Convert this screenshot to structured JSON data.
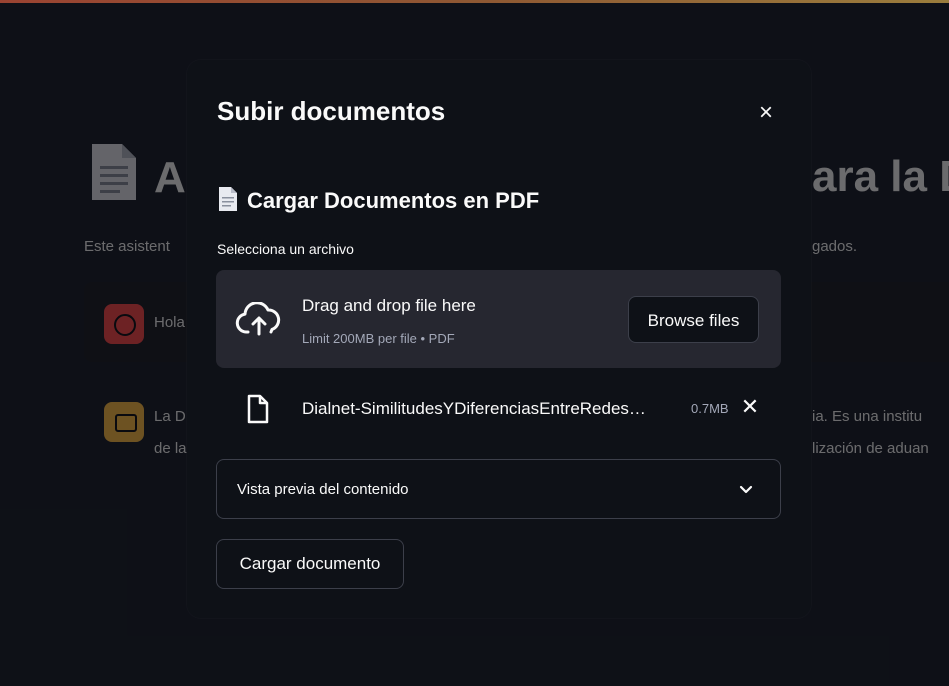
{
  "background": {
    "title_left": "A",
    "title_right": "ara la D",
    "caption_left": "Este asistent",
    "caption_right": "gados.",
    "user_message": "Hola",
    "bot_line1_left": "La D",
    "bot_line1_right": "ia. Es una institu",
    "bot_line2_left": "de la",
    "bot_line2_right": "lización de aduan"
  },
  "modal": {
    "title": "Subir documentos",
    "close_label": "×",
    "section_title": "Cargar Documentos en PDF",
    "uploader": {
      "label": "Selecciona un archivo",
      "drop_text": "Drag and drop file here",
      "limit_text": "Limit 200MB per file • PDF",
      "browse_label": "Browse files"
    },
    "uploaded_file": {
      "name": "Dialnet-SimilitudesYDiferenciasEntreRedes…",
      "size": "0.7MB",
      "remove_label": "✕"
    },
    "expander_label": "Vista previa del contenido",
    "submit_label": "Cargar documento"
  },
  "icons": {
    "document": "document-icon",
    "cloud_upload": "cloud-upload-icon",
    "file": "file-icon",
    "chevron": "chevron-down-icon"
  },
  "colors": {
    "background": "#0e1117",
    "dropzone": "#262730",
    "user_avatar": "#ff4b4b",
    "bot_avatar": "#ffbd45"
  }
}
